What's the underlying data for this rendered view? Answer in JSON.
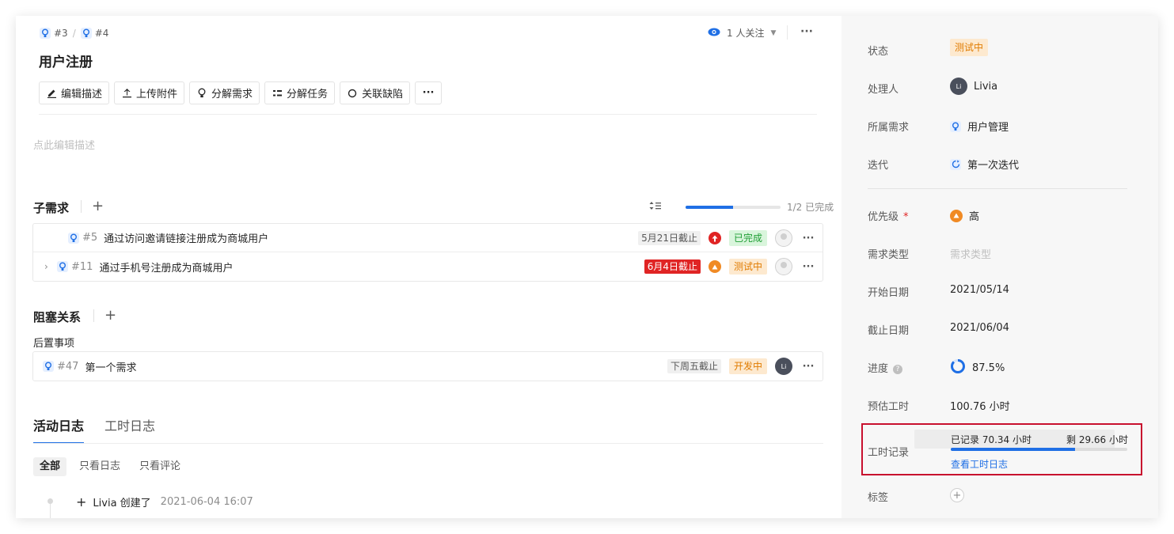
{
  "breadcrumb": {
    "items": [
      "#3",
      "#4"
    ],
    "sep": "/"
  },
  "watch": {
    "label": "1 人关注"
  },
  "title": "用户注册",
  "toolbar": {
    "edit_desc": "编辑描述",
    "upload": "上传附件",
    "split_req": "分解需求",
    "split_task": "分解任务",
    "link_bug": "关联缺陷"
  },
  "description_placeholder": "点此编辑描述",
  "subreq": {
    "title": "子需求",
    "progress_label": "1/2 已完成",
    "progress_fraction": 0.5,
    "rows": [
      {
        "num": "#5",
        "name": "通过访问邀请链接注册成为商城用户",
        "due": "5月21日截止",
        "status": "已完成"
      },
      {
        "num": "#11",
        "name": "通过手机号注册成为商城用户",
        "due": "6月4日截止",
        "status": "测试中"
      }
    ]
  },
  "blocking": {
    "title": "阻塞关系",
    "subtitle": "后置事项",
    "rows": [
      {
        "num": "#47",
        "name": "第一个需求",
        "due": "下周五截止",
        "status": "开发中"
      }
    ]
  },
  "activity": {
    "tabs": [
      "活动日志",
      "工时日志"
    ],
    "filters": [
      "全部",
      "只看日志",
      "只看评论"
    ],
    "log": {
      "text": "Livia 创建了",
      "time": "2021-06-04 16:07"
    }
  },
  "sidebar": {
    "status": {
      "label": "状态",
      "value": "测试中"
    },
    "assignee": {
      "label": "处理人",
      "value": "Livia"
    },
    "parent": {
      "label": "所属需求",
      "value": "用户管理"
    },
    "iteration": {
      "label": "迭代",
      "value": "第一次迭代"
    },
    "priority": {
      "label": "优先级",
      "star": "*",
      "value": "高"
    },
    "req_type": {
      "label": "需求类型",
      "value": "需求类型"
    },
    "start": {
      "label": "开始日期",
      "value": "2021/05/14"
    },
    "due": {
      "label": "截止日期",
      "value": "2021/06/04"
    },
    "progress": {
      "label": "进度",
      "value": "87.5%",
      "fraction": 0.875
    },
    "estimate": {
      "label": "预估工时",
      "value": "100.76 小时"
    },
    "worklog": {
      "label": "工时记录",
      "recorded": "已记录 70.34 小时",
      "remaining": "剩 29.66 小时",
      "fraction": 0.7035,
      "link": "查看工时日志"
    },
    "tags": {
      "label": "标签"
    }
  },
  "colors": {
    "accent": "#1f6fe5",
    "danger": "#e02424",
    "warning": "#e07b00",
    "success": "#1f9e34",
    "highlight": "#c8102e"
  }
}
